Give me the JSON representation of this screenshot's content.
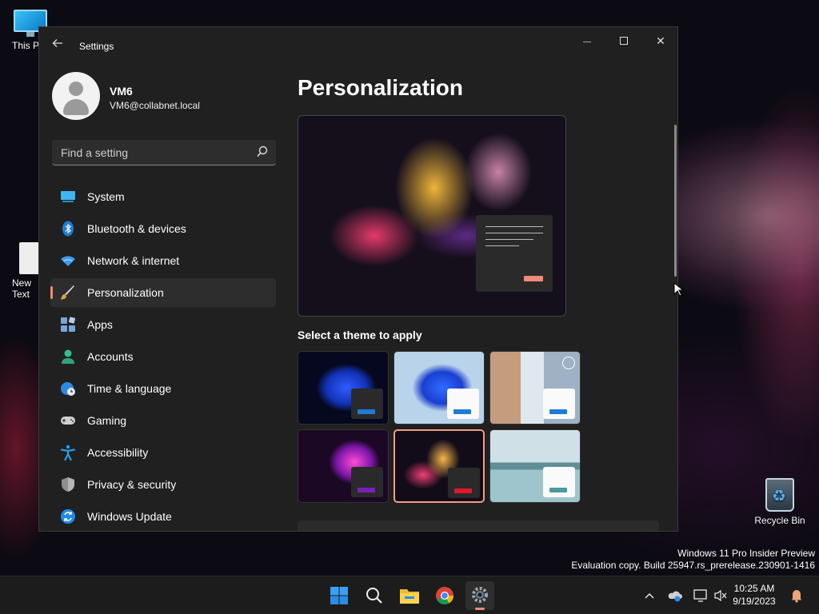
{
  "desktop": {
    "icons": [
      {
        "label": "This PC"
      },
      {
        "label": "New Text Document"
      },
      {
        "label": "Recycle Bin"
      }
    ]
  },
  "window": {
    "title": "Settings",
    "controls": {
      "minimize": "—",
      "close": "✕"
    }
  },
  "profile": {
    "name": "VM6",
    "email": "VM6@collabnet.local"
  },
  "search": {
    "placeholder": "Find a setting"
  },
  "sidebar": {
    "items": [
      {
        "label": "System",
        "icon": "monitor-icon",
        "active": false
      },
      {
        "label": "Bluetooth & devices",
        "icon": "bluetooth-icon",
        "active": false
      },
      {
        "label": "Network & internet",
        "icon": "wifi-icon",
        "active": false
      },
      {
        "label": "Personalization",
        "icon": "paintbrush-icon",
        "active": true
      },
      {
        "label": "Apps",
        "icon": "apps-icon",
        "active": false
      },
      {
        "label": "Accounts",
        "icon": "person-icon",
        "active": false
      },
      {
        "label": "Time & language",
        "icon": "globe-clock-icon",
        "active": false
      },
      {
        "label": "Gaming",
        "icon": "gamepad-icon",
        "active": false
      },
      {
        "label": "Accessibility",
        "icon": "accessibility-icon",
        "active": false
      },
      {
        "label": "Privacy & security",
        "icon": "shield-icon",
        "active": false
      },
      {
        "label": "Windows Update",
        "icon": "update-icon",
        "active": false
      }
    ]
  },
  "main": {
    "title": "Personalization",
    "theme_section_label": "Select a theme to apply",
    "themes": [
      {
        "id": "windows-dark",
        "selected": false,
        "accent": "#1e7bd6"
      },
      {
        "id": "windows-light",
        "selected": false,
        "accent": "#1e7bd6"
      },
      {
        "id": "spotlight",
        "selected": false,
        "accent": "#1e7bd6"
      },
      {
        "id": "glow",
        "selected": false,
        "accent": "#7a1fb8"
      },
      {
        "id": "captured-motion",
        "selected": true,
        "accent": "#e0182b"
      },
      {
        "id": "flow",
        "selected": false,
        "accent": "#4a9aa0"
      }
    ]
  },
  "watermark": {
    "line1": "Windows 11 Pro Insider Preview",
    "line2": "Evaluation copy. Build 25947.rs_prerelease.230901-1416"
  },
  "taskbar": {
    "apps": [
      "start-icon",
      "search-icon",
      "file-explorer-icon",
      "chrome-icon",
      "settings-icon"
    ],
    "clock": {
      "time": "10:25 AM",
      "date": "9/19/2023"
    }
  },
  "colors": {
    "accent": "#f08a76",
    "window_bg": "#202020",
    "nav_active_bg": "#2d2d2d"
  }
}
